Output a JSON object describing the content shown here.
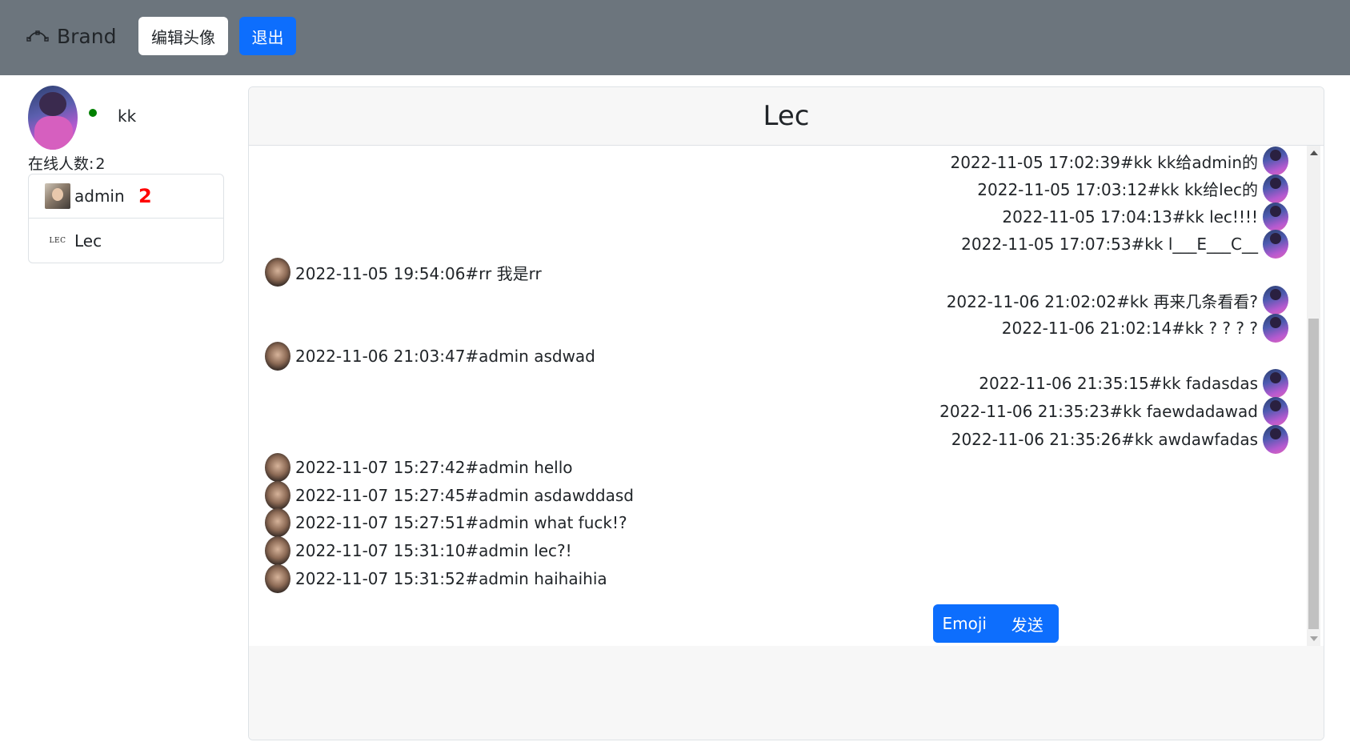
{
  "navbar": {
    "brand": "Brand",
    "brand_icon": "bezier-curve-icon",
    "edit_avatar_label": "编辑头像",
    "logout_label": "退出"
  },
  "me": {
    "name": "kk",
    "status": "online",
    "status_color": "#008000"
  },
  "online": {
    "label": "在线人数:",
    "count": "2"
  },
  "users": [
    {
      "name": "admin",
      "unread": "2"
    },
    {
      "name": "Lec",
      "thumb_text": "LEC"
    }
  ],
  "chat": {
    "title": "Lec",
    "messages": [
      {
        "side": "right",
        "sender": "kk",
        "text": "2022-11-05 17:02:39#kk  kk给admin的"
      },
      {
        "side": "right",
        "sender": "kk",
        "text": "2022-11-05 17:03:12#kk  kk给lec的"
      },
      {
        "side": "right",
        "sender": "kk",
        "text": "2022-11-05 17:04:13#kk  lec!!!!"
      },
      {
        "side": "right",
        "sender": "kk",
        "text": "2022-11-05 17:07:53#kk  l___E___C__"
      },
      {
        "side": "left",
        "sender": "rr",
        "text": "2022-11-05 19:54:06#rr  我是rr"
      },
      {
        "side": "right",
        "sender": "kk",
        "text": "2022-11-06 21:02:02#kk  再来几条看看?"
      },
      {
        "side": "right",
        "sender": "kk",
        "text": "2022-11-06 21:02:14#kk  ? ? ? ?"
      },
      {
        "side": "left",
        "sender": "admin",
        "text": "2022-11-06 21:03:47#admin  asdwad"
      },
      {
        "side": "right",
        "sender": "kk",
        "text": "2022-11-06 21:35:15#kk  fadasdas"
      },
      {
        "side": "right",
        "sender": "kk",
        "text": "2022-11-06 21:35:23#kk  faewdadawad"
      },
      {
        "side": "right",
        "sender": "kk",
        "text": "2022-11-06 21:35:26#kk  awdawfadas"
      },
      {
        "side": "left",
        "sender": "admin",
        "text": "2022-11-07 15:27:42#admin  hello"
      },
      {
        "side": "left",
        "sender": "admin",
        "text": "2022-11-07 15:27:45#admin  asdawddasd"
      },
      {
        "side": "left",
        "sender": "admin",
        "text": "2022-11-07 15:27:51#admin  what fuck!?"
      },
      {
        "side": "left",
        "sender": "admin",
        "text": "2022-11-07 15:31:10#admin  lec?!"
      },
      {
        "side": "left",
        "sender": "admin",
        "text": "2022-11-07 15:31:52#admin  haihaihia"
      }
    ],
    "emoji_label": "Emoji",
    "send_label": "发送"
  },
  "colors": {
    "navbar_bg": "#6c757d",
    "primary": "#0d6efd",
    "unread": "#ff0000"
  }
}
